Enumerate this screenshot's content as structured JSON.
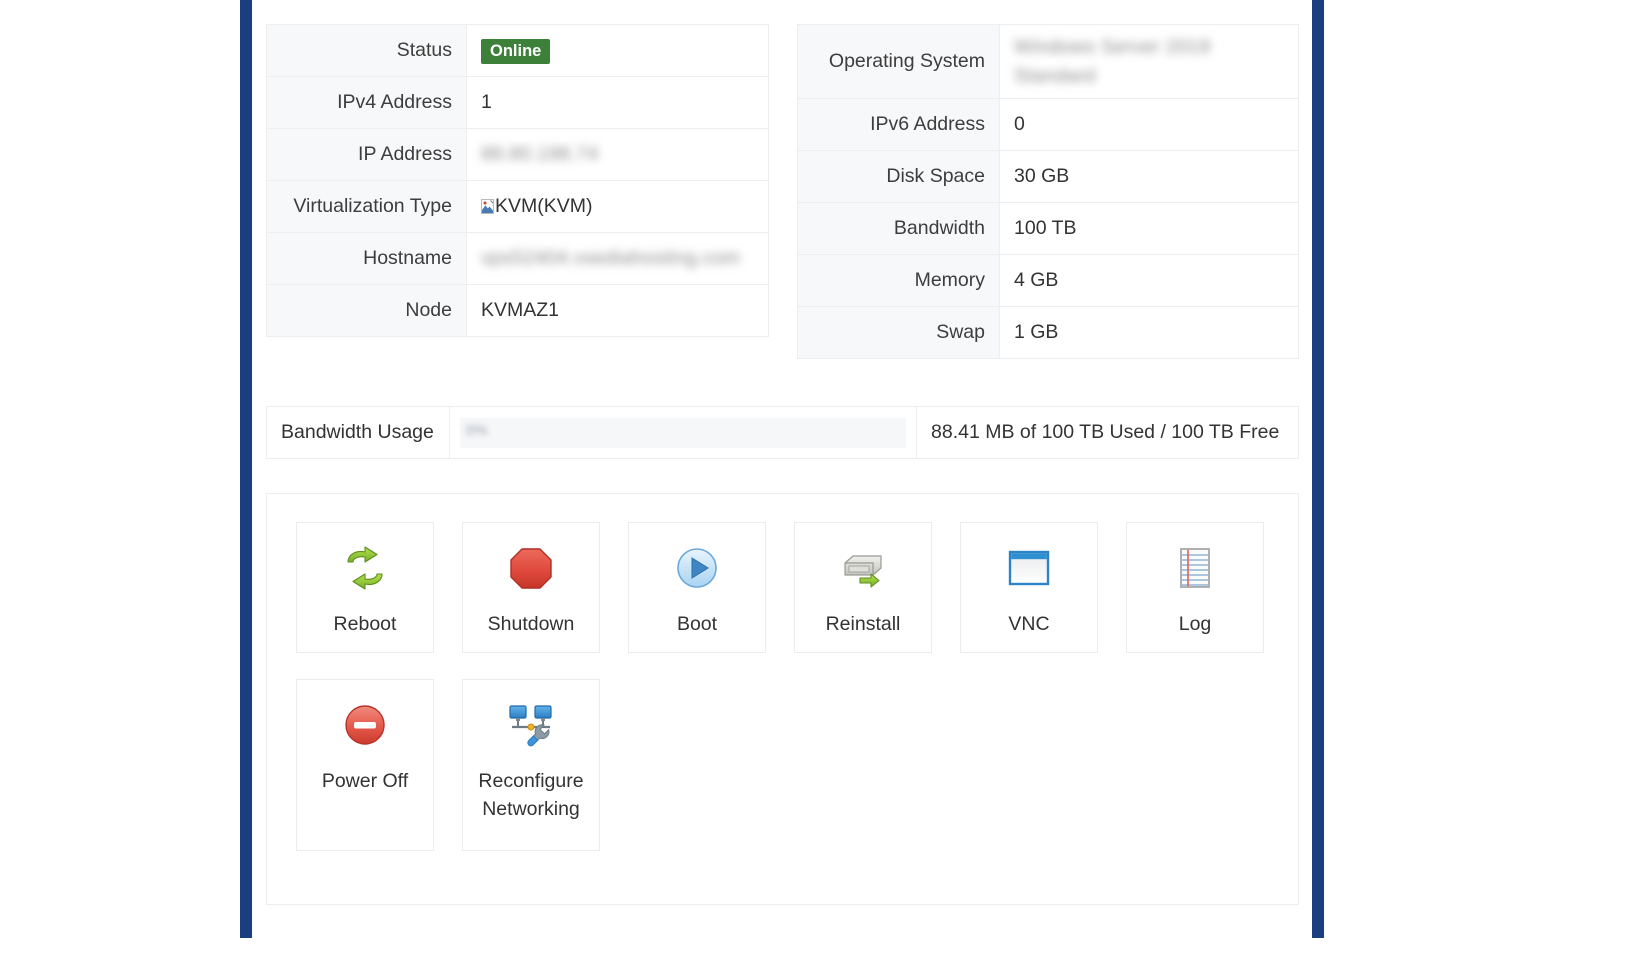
{
  "theme": {
    "frame_color": "#1a3e7e",
    "badge_green": "#3c8039",
    "text_color": "#333333",
    "row_alt_bg": "#f7f8f9",
    "border_color": "#eceeef"
  },
  "left_table": {
    "rows": [
      {
        "label": "Status",
        "value": "Online",
        "type": "badge"
      },
      {
        "label": "IPv4 Address",
        "value": "1",
        "type": "text"
      },
      {
        "label": "IP Address",
        "value": "88.80.198.74",
        "type": "redacted"
      },
      {
        "label": "Virtualization Type",
        "value": "KVM(KVM)",
        "type": "icon-text"
      },
      {
        "label": "Hostname",
        "value": "vps52404.vsediahosting.com",
        "type": "redacted"
      },
      {
        "label": "Node",
        "value": "KVMAZ1",
        "type": "text"
      }
    ]
  },
  "right_table": {
    "rows": [
      {
        "label": "Operating System",
        "value": "Windows Server 2019\nStandard",
        "type": "redacted"
      },
      {
        "label": "IPv6 Address",
        "value": "0",
        "type": "text"
      },
      {
        "label": "Disk Space",
        "value": "30 GB",
        "type": "text"
      },
      {
        "label": "Bandwidth",
        "value": "100 TB",
        "type": "text"
      },
      {
        "label": "Memory",
        "value": "4 GB",
        "type": "text"
      },
      {
        "label": "Swap",
        "value": "1 GB",
        "type": "text"
      }
    ]
  },
  "bandwidth": {
    "label": "Bandwidth Usage",
    "progress_label": "0%",
    "progress_percent": 0,
    "summary": "88.41 MB of 100 TB Used / 100 TB Free"
  },
  "actions": {
    "items": [
      {
        "label": "Reboot",
        "icon": "reboot-arrows-icon"
      },
      {
        "label": "Shutdown",
        "icon": "stop-octagon-icon"
      },
      {
        "label": "Boot",
        "icon": "play-circle-icon"
      },
      {
        "label": "Reinstall",
        "icon": "disk-arrow-icon"
      },
      {
        "label": "VNC",
        "icon": "window-icon"
      },
      {
        "label": "Log",
        "icon": "notepad-lines-icon"
      },
      {
        "label": "Power Off",
        "icon": "power-off-circle-icon"
      },
      {
        "label": "Reconfigure\nNetworking",
        "icon": "network-wrench-icon"
      }
    ]
  }
}
